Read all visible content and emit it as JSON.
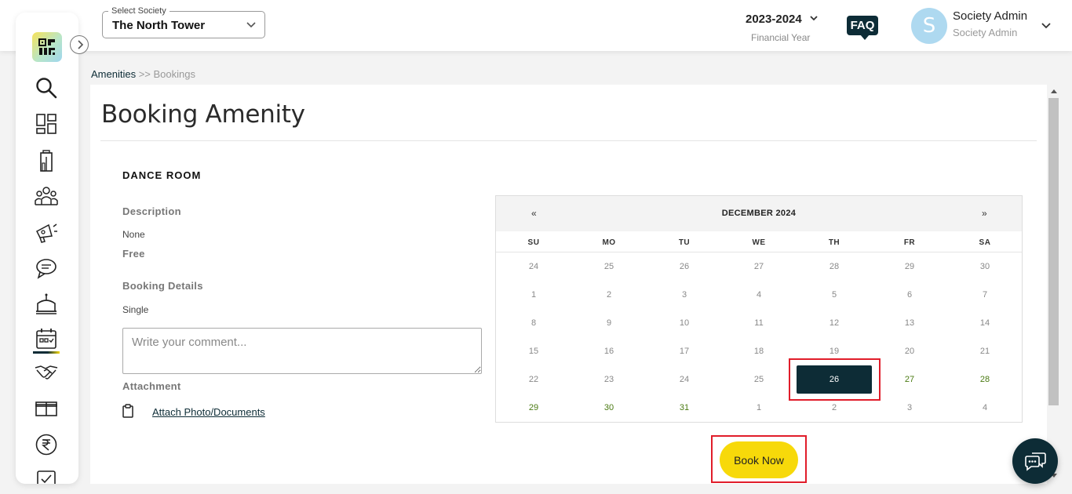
{
  "header": {
    "society_legend": "Select Society",
    "society_value": "The North Tower",
    "financial_year": "2023-2024",
    "financial_year_label": "Financial Year",
    "faq_label": "FAQ",
    "avatar_initial": "S",
    "user_name": "Society Admin",
    "user_role": "Society Admin"
  },
  "sidebar": {
    "logo_icon": "qr-logo-icon",
    "items": [
      "search-icon",
      "dashboard-icon",
      "building-icon",
      "members-icon",
      "announcement-icon",
      "chat-icon",
      "facilities-icon",
      "calendar-icon",
      "handshake-icon",
      "package-icon",
      "rupee-icon",
      "task-icon"
    ],
    "active_item": "calendar-icon"
  },
  "breadcrumb": {
    "parent": "Amenities",
    "separator": ">>",
    "current": "Bookings"
  },
  "page": {
    "title": "Booking Amenity",
    "amenity_name": "DANCE ROOM",
    "description_label": "Description",
    "description_value": "None",
    "price_label": "Free",
    "booking_details_label": "Booking Details",
    "booking_type": "Single",
    "comment_placeholder": "Write your comment...",
    "attachment_label": "Attachment",
    "attach_link": "Attach Photo/Documents",
    "book_button": "Book Now"
  },
  "calendar": {
    "prev": "«",
    "next": "»",
    "month": "DECEMBER 2024",
    "weekdays": [
      "SU",
      "MO",
      "TU",
      "WE",
      "TH",
      "FR",
      "SA"
    ],
    "weeks": [
      [
        "24",
        "25",
        "26",
        "27",
        "28",
        "29",
        "30"
      ],
      [
        "1",
        "2",
        "3",
        "4",
        "5",
        "6",
        "7"
      ],
      [
        "8",
        "9",
        "10",
        "11",
        "12",
        "13",
        "14"
      ],
      [
        "15",
        "16",
        "17",
        "18",
        "19",
        "20",
        "21"
      ],
      [
        "22",
        "23",
        "24",
        "25",
        "26",
        "27",
        "28"
      ],
      [
        "29",
        "30",
        "31",
        "1",
        "2",
        "3",
        "4"
      ]
    ],
    "available_days": [
      "26",
      "27",
      "28",
      "29",
      "30",
      "31"
    ],
    "selected_day": "26"
  },
  "colors": {
    "primary": "#0d2c36",
    "accent": "#f7d90a",
    "available": "#4a7a12",
    "highlight": "#e11d2a"
  }
}
